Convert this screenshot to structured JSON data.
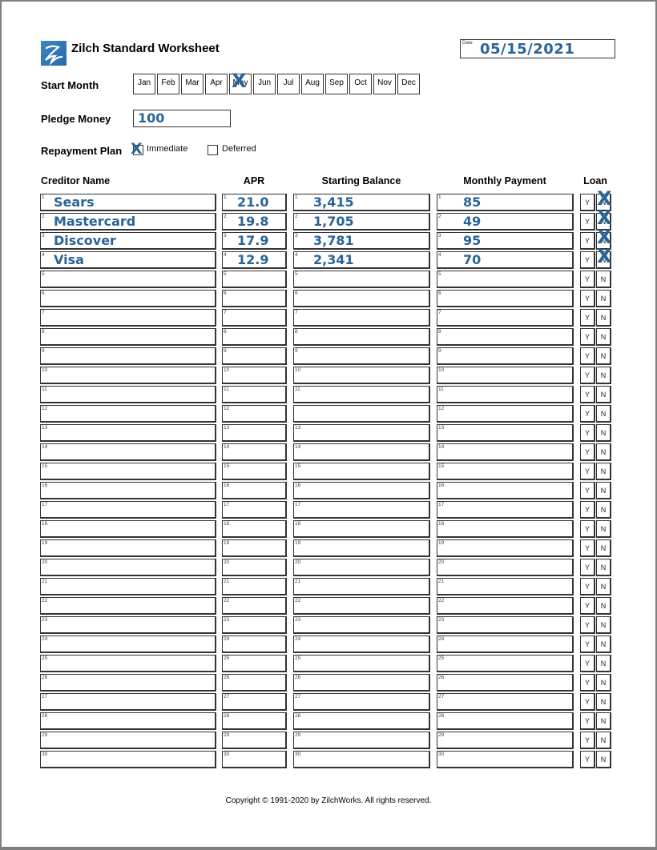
{
  "header": {
    "logo_icon": "zilchworks-logo-icon",
    "title": "Zilch Standard Worksheet",
    "date_label": "Date",
    "date_value": "05/15/2021"
  },
  "start_month": {
    "label": "Start Month",
    "months": [
      "Jan",
      "Feb",
      "Mar",
      "Apr",
      "May",
      "Jun",
      "Jul",
      "Aug",
      "Sep",
      "Oct",
      "Nov",
      "Dec"
    ],
    "selected": "May"
  },
  "pledge": {
    "label": "Pledge Money",
    "value": "100"
  },
  "repayment": {
    "label": "Repayment Plan",
    "options": [
      {
        "label": "Immediate",
        "checked": true
      },
      {
        "label": "Deferred",
        "checked": false
      }
    ]
  },
  "table": {
    "headers": {
      "creditor": "Creditor Name",
      "apr": "APR",
      "balance": "Starting Balance",
      "payment": "Monthly Payment",
      "loan": "Loan"
    },
    "loan_yes": "Y",
    "loan_no": "N",
    "mark_glyph": "X",
    "rows": [
      {
        "n": "1",
        "creditor": "Sears",
        "apr": "21.0",
        "balance": "3,415",
        "payment": "85",
        "loan": "N"
      },
      {
        "n": "2",
        "creditor": "Mastercard",
        "apr": "19.8",
        "balance": "1,705",
        "payment": "49",
        "loan": "N"
      },
      {
        "n": "3",
        "creditor": "Discover",
        "apr": "17.9",
        "balance": "3,781",
        "payment": "95",
        "loan": "N"
      },
      {
        "n": "4",
        "creditor": "Visa",
        "apr": "12.9",
        "balance": "2,341",
        "payment": "70",
        "loan": "N"
      },
      {
        "n": "5"
      },
      {
        "n": "6"
      },
      {
        "n": "7"
      },
      {
        "n": "8"
      },
      {
        "n": "9"
      },
      {
        "n": "10"
      },
      {
        "n": "11"
      },
      {
        "n": "12",
        "balance_num_hidden": true
      },
      {
        "n": "13"
      },
      {
        "n": "14"
      },
      {
        "n": "15"
      },
      {
        "n": "16"
      },
      {
        "n": "17"
      },
      {
        "n": "18"
      },
      {
        "n": "19"
      },
      {
        "n": "20"
      },
      {
        "n": "21"
      },
      {
        "n": "22"
      },
      {
        "n": "23"
      },
      {
        "n": "24"
      },
      {
        "n": "25"
      },
      {
        "n": "26"
      },
      {
        "n": "27"
      },
      {
        "n": "28"
      },
      {
        "n": "29"
      },
      {
        "n": "30"
      }
    ]
  },
  "footer": {
    "copyright": "Copyright © 1991-2020 by ZilchWorks. All rights reserved."
  },
  "colors": {
    "handwriting": "#2a6496",
    "border": "#333333",
    "page_frame": "#808080",
    "logo": "#3b86c6"
  }
}
